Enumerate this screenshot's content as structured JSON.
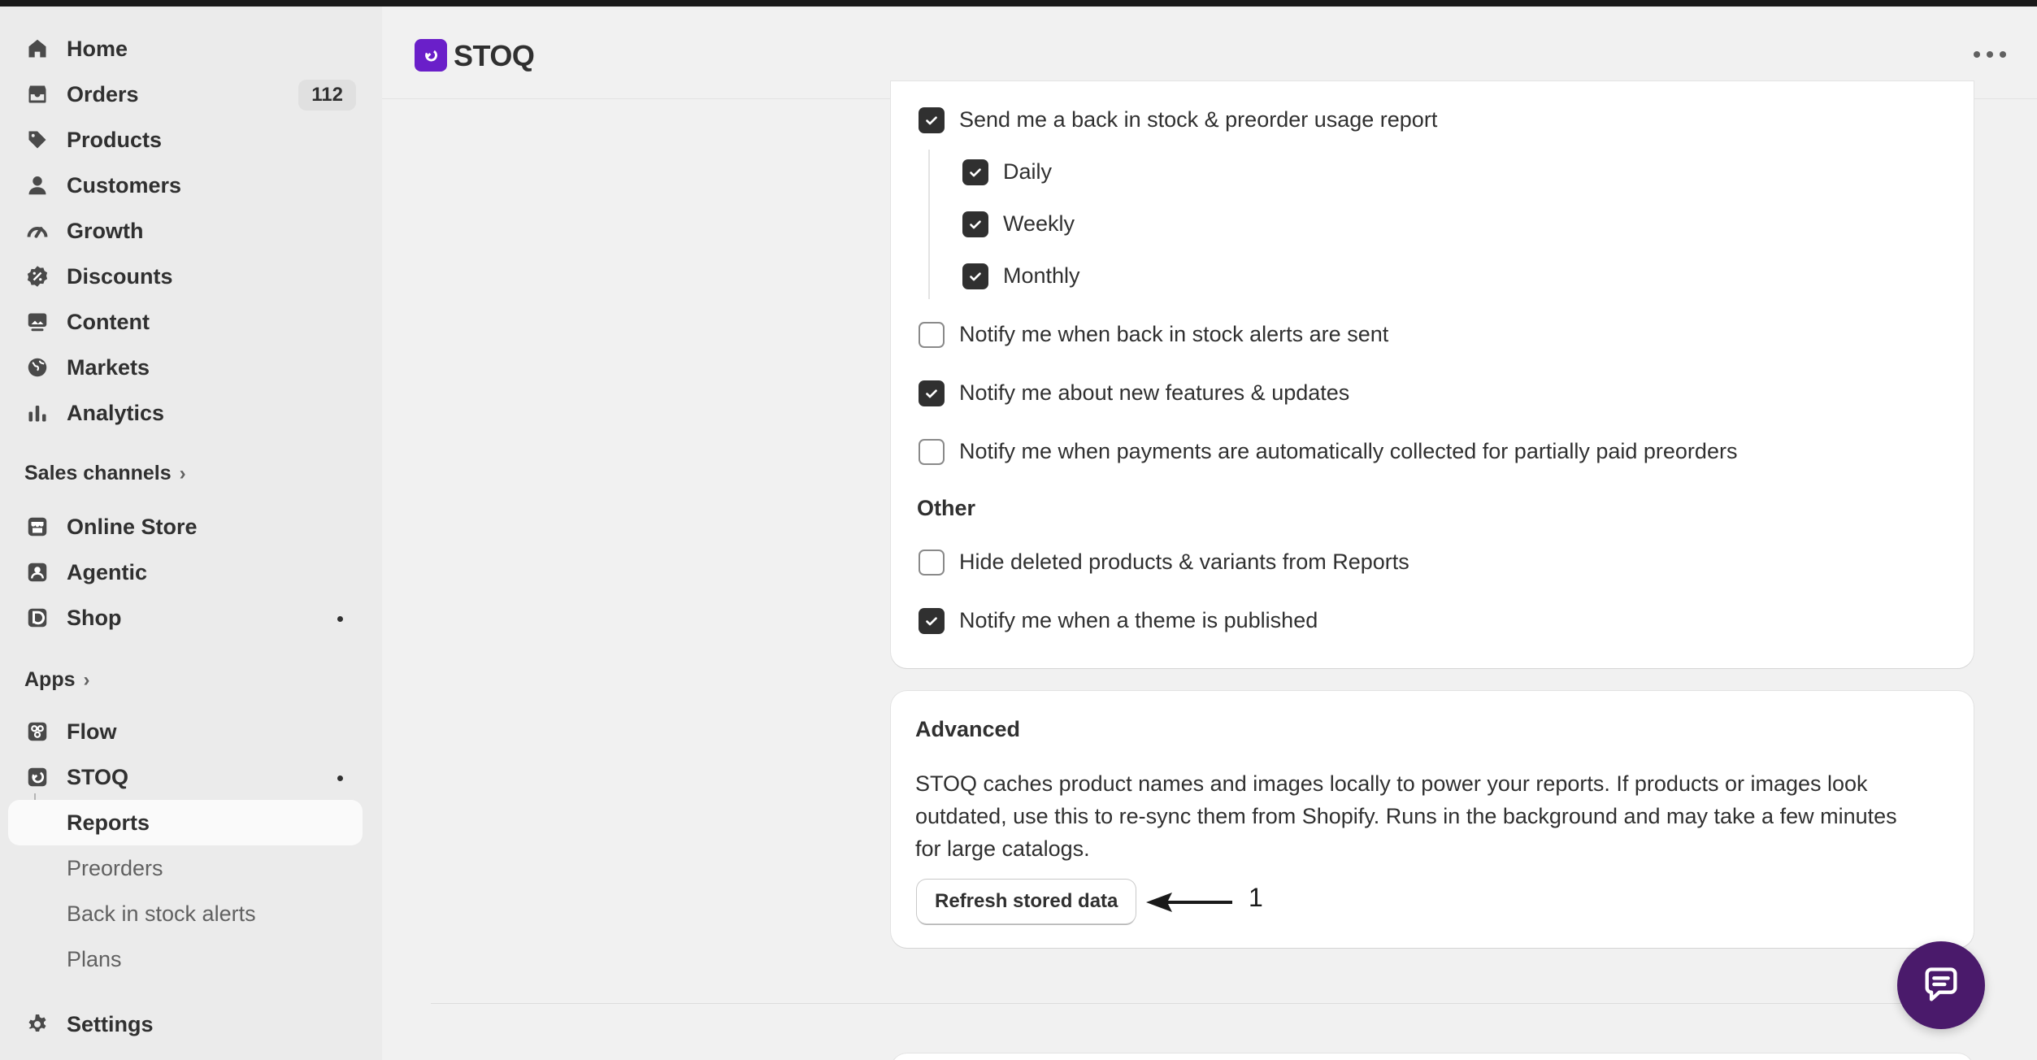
{
  "app": {
    "title": "STOQ"
  },
  "sidebar": {
    "main_items": [
      {
        "label": "Home",
        "icon": "home-icon"
      },
      {
        "label": "Orders",
        "icon": "orders-icon",
        "badge": "112"
      },
      {
        "label": "Products",
        "icon": "tag-icon"
      },
      {
        "label": "Customers",
        "icon": "person-icon"
      },
      {
        "label": "Growth",
        "icon": "gauge-icon"
      },
      {
        "label": "Discounts",
        "icon": "discount-icon"
      },
      {
        "label": "Content",
        "icon": "image-icon"
      },
      {
        "label": "Markets",
        "icon": "globe-icon"
      },
      {
        "label": "Analytics",
        "icon": "bar-chart-icon"
      }
    ],
    "sales_channels_label": "Sales channels",
    "sales_channels": [
      {
        "label": "Online Store",
        "icon": "store-icon"
      },
      {
        "label": "Agentic",
        "icon": "agentic-icon"
      },
      {
        "label": "Shop",
        "icon": "shop-icon"
      }
    ],
    "apps_label": "Apps",
    "apps": [
      {
        "label": "Flow",
        "icon": "flow-icon"
      },
      {
        "label": "STOQ",
        "icon": "stoq-icon"
      }
    ],
    "stoq_subitems": [
      "Reports",
      "Preorders",
      "Back in stock alerts",
      "Plans"
    ],
    "settings_label": "Settings"
  },
  "notifications": {
    "usage_report": {
      "label": "Send me a back in stock & preorder usage report",
      "checked": true
    },
    "frequency": [
      {
        "label": "Daily",
        "checked": true
      },
      {
        "label": "Weekly",
        "checked": true
      },
      {
        "label": "Monthly",
        "checked": true
      }
    ],
    "options": [
      {
        "label": "Notify me when back in stock alerts are sent",
        "checked": false
      },
      {
        "label": "Notify me about new features & updates",
        "checked": true
      },
      {
        "label": "Notify me when payments are automatically collected for partially paid preorders",
        "checked": false
      }
    ],
    "other_heading": "Other",
    "other_options": [
      {
        "label": "Hide deleted products & variants from Reports",
        "checked": false
      },
      {
        "label": "Notify me when a theme is published",
        "checked": true
      }
    ]
  },
  "advanced": {
    "heading": "Advanced",
    "description_line1": "STOQ caches product names and images locally to power your reports. If products or images look",
    "description_line2": "outdated, use this to re-sync them from Shopify. Runs in the background and may take a few minutes",
    "description_line3": "for large catalogs.",
    "refresh_button": "Refresh stored data",
    "annotation": "1"
  }
}
